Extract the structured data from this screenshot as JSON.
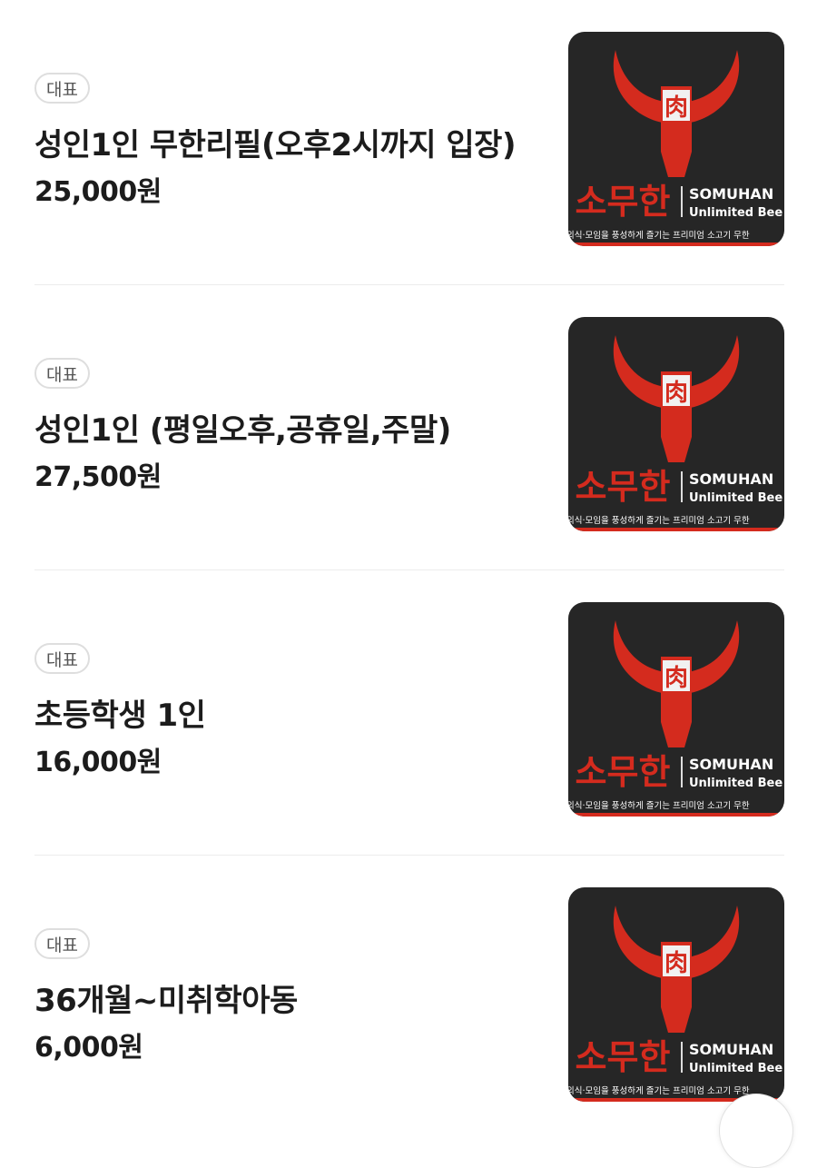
{
  "menu": {
    "items": [
      {
        "badge": "대표",
        "name": "성인1인 무한리필(오후2시까지 입장)",
        "price": "25,000원",
        "image": {
          "label_hanja": "肉",
          "brand_ko": "소무한",
          "brand_en": "SOMUHAN",
          "tagline_en": "Unlimited Bee",
          "caption": "외식·모임을 풍성하게 즐기는 프리미엄 소고기 무한"
        }
      },
      {
        "badge": "대표",
        "name": "성인1인 (평일오후,공휴일,주말)",
        "price": "27,500원",
        "image": {
          "label_hanja": "肉",
          "brand_ko": "소무한",
          "brand_en": "SOMUHAN",
          "tagline_en": "Unlimited Bee",
          "caption": "외식·모임을 풍성하게 즐기는 프리미엄 소고기 무한"
        }
      },
      {
        "badge": "대표",
        "name": "초등학생 1인",
        "price": "16,000원",
        "image": {
          "label_hanja": "肉",
          "brand_ko": "소무한",
          "brand_en": "SOMUHAN",
          "tagline_en": "Unlimited Bee",
          "caption": "외식·모임을 풍성하게 즐기는 프리미엄 소고기 무한"
        }
      },
      {
        "badge": "대표",
        "name": "36개월~미취학아동",
        "price": "6,000원",
        "image": {
          "label_hanja": "肉",
          "brand_ko": "소무한",
          "brand_en": "SOMUHAN",
          "tagline_en": "Unlimited Bee",
          "caption": "외식·모임을 풍성하게 즐기는 프리미엄 소고기 무한"
        }
      }
    ]
  },
  "colors": {
    "brand_red": "#d42b1e",
    "image_bg": "#2a2a2a",
    "divider": "#ececec"
  }
}
